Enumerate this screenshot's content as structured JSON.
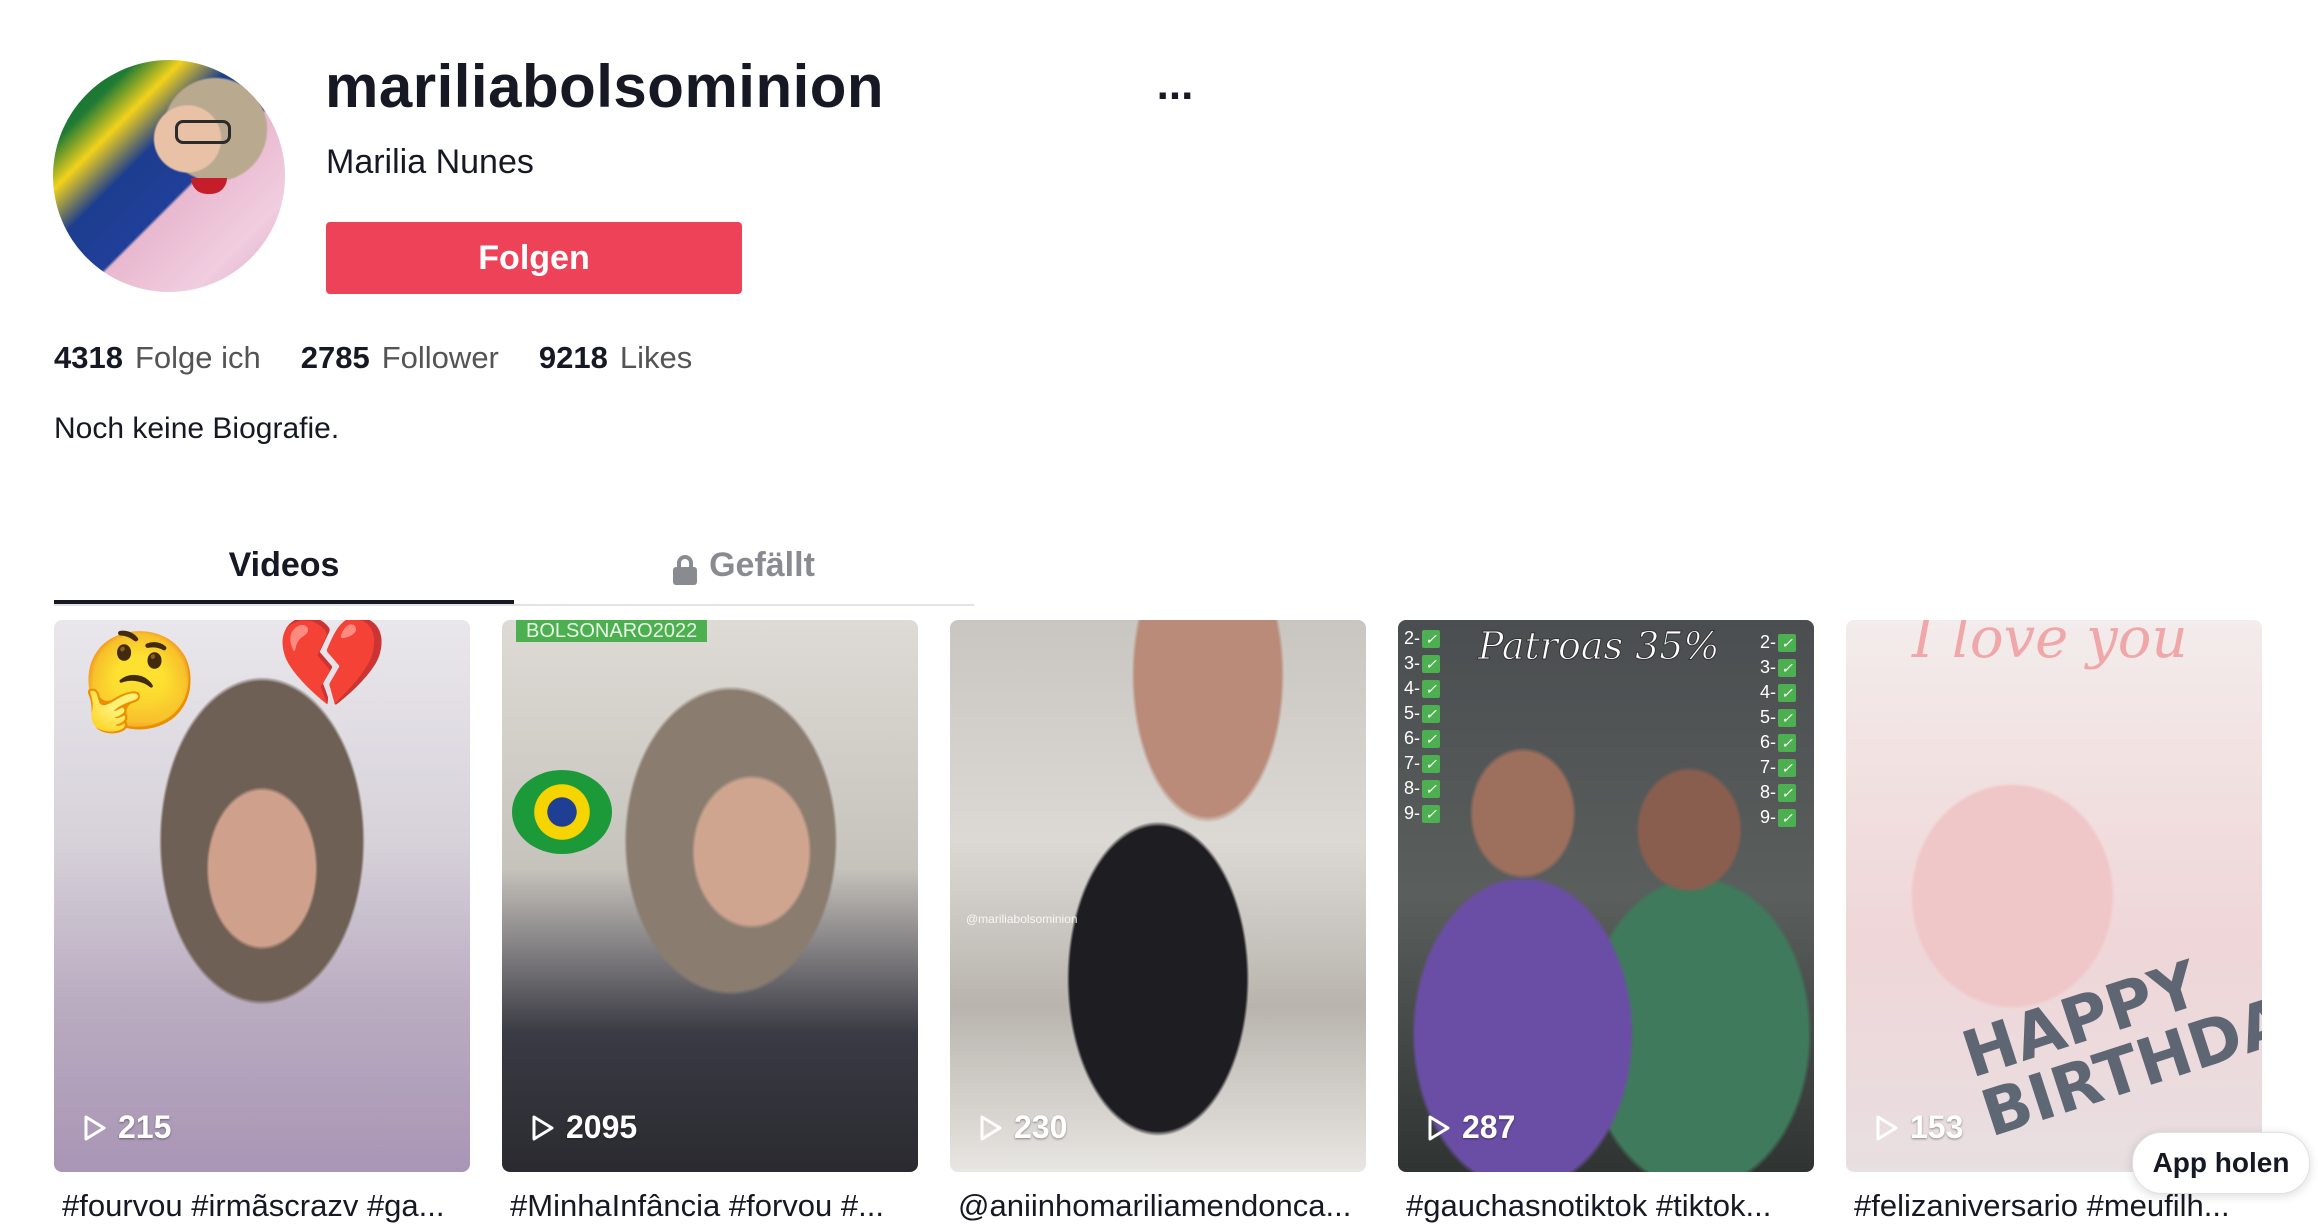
{
  "profile": {
    "username": "mariliabolsominion",
    "nickname": "Marilia Nunes",
    "follow_label": "Folgen",
    "more_label": "...",
    "bio": "Noch keine Biografie."
  },
  "stats": [
    {
      "value": "4318",
      "label": "Folge ich"
    },
    {
      "value": "2785",
      "label": "Follower"
    },
    {
      "value": "9218",
      "label": "Likes"
    }
  ],
  "tabs": {
    "videos": "Videos",
    "liked": "Gefällt"
  },
  "videos": [
    {
      "views": "215",
      "caption": "#fourvou #irmãscrazv #ga..."
    },
    {
      "views": "2095",
      "caption": "#MinhaInfância #forvou #..."
    },
    {
      "views": "230",
      "caption": "@aniinhomariliamendonca..."
    },
    {
      "views": "287",
      "caption": "#gauchasnotiktok #tiktok..."
    },
    {
      "views": "153",
      "caption": "#felizaniversario #meufilh..."
    }
  ],
  "overlays": {
    "v2_banner": "BOLSONARO2022",
    "v3_watermark": "@mariliabolsominion",
    "v4_title": "Patroas 35%",
    "v5_title": "I love you",
    "v5_happy": "HAPPY",
    "v5_birthday": "BIRTHDAY",
    "checklist": [
      "2-",
      "3-",
      "4-",
      "5-",
      "6-",
      "7-",
      "8-",
      "9-"
    ]
  },
  "app_button": "App holen",
  "colors": {
    "follow": "#ee4258",
    "text": "#161823",
    "muted": "#8a8b91"
  }
}
